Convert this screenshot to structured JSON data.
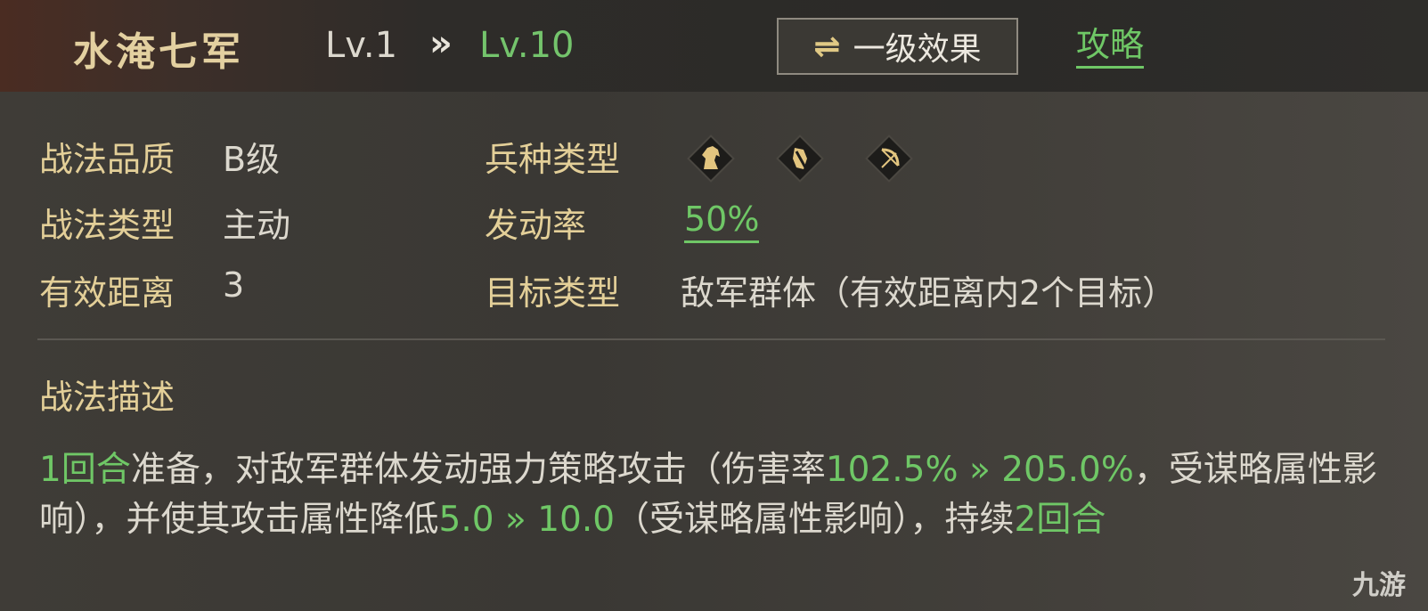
{
  "header": {
    "title": "水淹七军",
    "level_from": "Lv.1",
    "level_arrow": "»",
    "level_to": "Lv.10",
    "effect_button": {
      "icon": "⇌",
      "label": "一级效果"
    },
    "guide_link": "攻略"
  },
  "stats": {
    "quality_label": "战法品质",
    "quality_value": "B级",
    "type_label": "战法类型",
    "type_value": "主动",
    "range_label": "有效距离",
    "range_value": "3",
    "troop_label": "兵种类型",
    "troop_icons": [
      "cavalry-horse-icon",
      "shield-infantry-icon",
      "archer-bow-icon"
    ],
    "rate_label": "发动率",
    "rate_value": "50%",
    "target_label": "目标类型",
    "target_value": "敌军群体（有效距离内2个目标）"
  },
  "description": {
    "title": "战法描述",
    "segments": [
      {
        "text": "1回合",
        "green": true
      },
      {
        "text": "准备，对敌军群体发动强力策略攻击（伤害率",
        "green": false
      },
      {
        "text": "102.5% » 205.0%",
        "green": true
      },
      {
        "text": "，受谋略属性影响），并使其攻击属性降低",
        "green": false
      },
      {
        "text": "5.0 » 10.0",
        "green": true
      },
      {
        "text": "（受谋略属性影响），持续",
        "green": false
      },
      {
        "text": "2回合",
        "green": true
      }
    ]
  },
  "colors": {
    "gold": "#e3cf98",
    "green": "#6fc766",
    "text": "#dcd8ce"
  },
  "watermark": "九游"
}
